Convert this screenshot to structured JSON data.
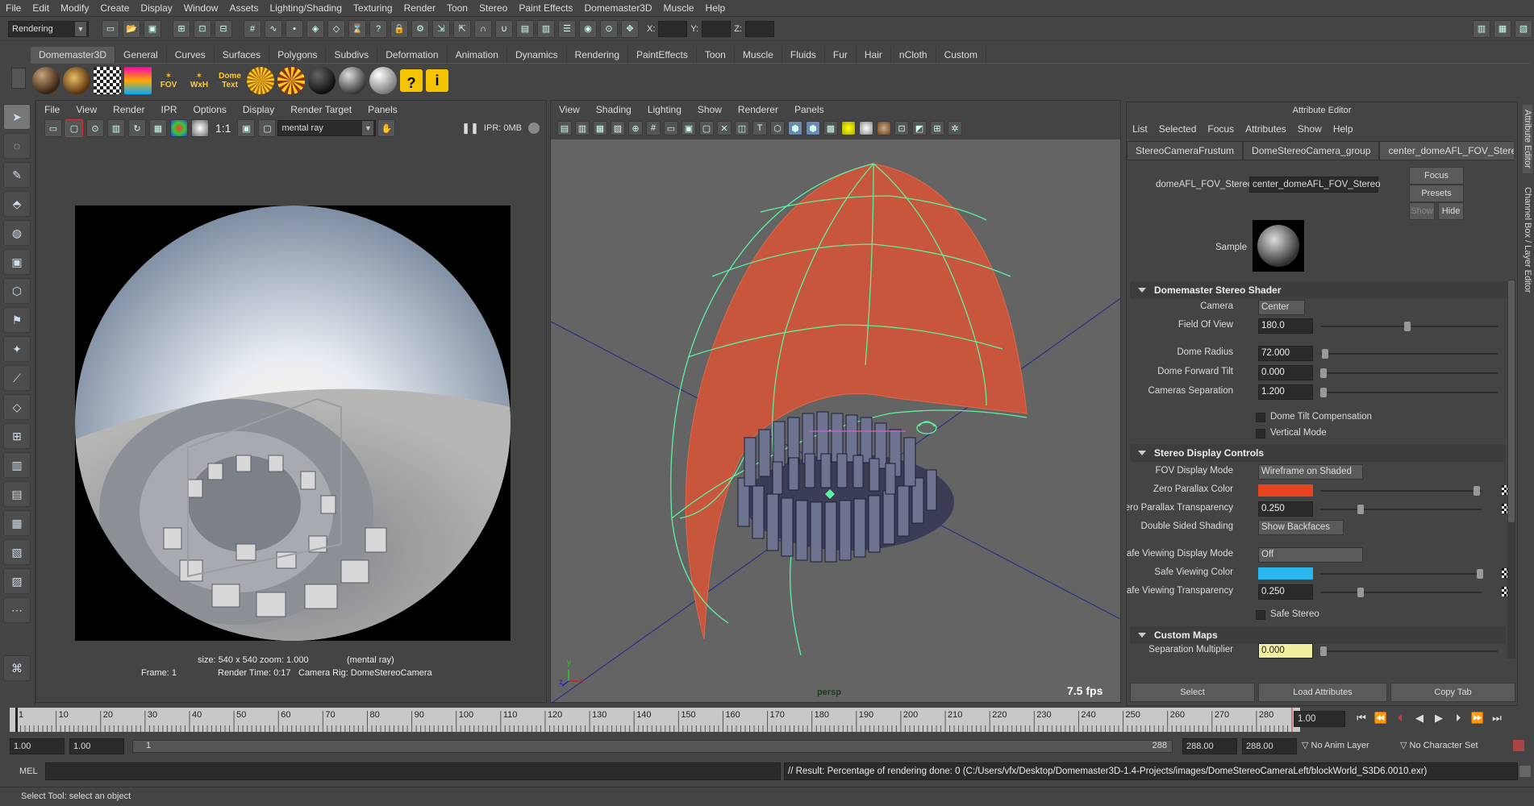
{
  "menubar": [
    "File",
    "Edit",
    "Modify",
    "Create",
    "Display",
    "Window",
    "Assets",
    "Lighting/Shading",
    "Texturing",
    "Render",
    "Toon",
    "Stereo",
    "Paint Effects",
    "Domemaster3D",
    "Muscle",
    "Help"
  ],
  "statusline": {
    "menuset": "Rendering",
    "x_label": "X:",
    "y_label": "Y:",
    "z_label": "Z:"
  },
  "shelf": {
    "tabs": [
      "Domemaster3D",
      "General",
      "Curves",
      "Surfaces",
      "Polygons",
      "Subdivs",
      "Deformation",
      "Animation",
      "Dynamics",
      "Rendering",
      "PaintEffects",
      "Toon",
      "Muscle",
      "Fluids",
      "Fur",
      "Hair",
      "nCloth",
      "Custom"
    ],
    "fov_label": "FOV",
    "wxh_label": "WxH",
    "dome_text_label": "Dome Text"
  },
  "renderview": {
    "menu": [
      "File",
      "View",
      "Render",
      "IPR",
      "Options",
      "Display",
      "Render Target",
      "Panels"
    ],
    "ratio": "1:1",
    "renderer": "mental ray",
    "ipr": "IPR: 0MB",
    "info_size": "size: 540 x 540 zoom: 1.000",
    "info_renderer": "(mental ray)",
    "info_frame": "Frame: 1",
    "info_time": "Render Time: 0:17",
    "info_rig": "Camera Rig: DomeStereoCamera"
  },
  "viewport": {
    "menu": [
      "View",
      "Shading",
      "Lighting",
      "Show",
      "Renderer",
      "Panels"
    ],
    "camera_name": "persp",
    "fps": "7.5 fps",
    "axis_x": "x",
    "axis_y": "y",
    "axis_z": "z"
  },
  "ae": {
    "title": "Attribute Editor",
    "menu": [
      "List",
      "Selected",
      "Focus",
      "Attributes",
      "Show",
      "Help"
    ],
    "tabs": [
      "StereoCameraFrustum",
      "DomeStereoCamera_group",
      "center_domeAFL_FOV_Stereo"
    ],
    "node_label": "domeAFL_FOV_Stereo:",
    "node_value": "center_domeAFL_FOV_Stereo",
    "focus": "Focus",
    "presets": "Presets",
    "show": "Show",
    "hide": "Hide",
    "sample_label": "Sample",
    "section1": "Domemaster Stereo Shader",
    "camera_label": "Camera",
    "camera_value": "Center",
    "fov_label": "Field Of View",
    "fov_value": "180.0",
    "radius_label": "Dome Radius",
    "radius_value": "72.000",
    "tilt_label": "Dome Forward Tilt",
    "tilt_value": "0.000",
    "sep_label": "Cameras Separation",
    "sep_value": "1.200",
    "tilt_comp": "Dome Tilt Compensation",
    "vertical": "Vertical Mode",
    "section2": "Stereo Display Controls",
    "fovmode_label": "FOV Display Mode",
    "fovmode_value": "Wireframe on Shaded",
    "zpc_label": "Zero Parallax Color",
    "zpc_color": "#e8451f",
    "zpt_label": "Zero Parallax Transparency",
    "zpt_value": "0.250",
    "dss_label": "Double Sided Shading",
    "dss_value": "Show Backfaces",
    "svdm_label": "Safe Viewing Display Mode",
    "svdm_value": "Off",
    "svc_label": "Safe Viewing Color",
    "svc_color": "#2bb8f0",
    "svt_label": "Safe Viewing Transparency",
    "svt_value": "0.250",
    "safe_stereo": "Safe Stereo",
    "section3": "Custom Maps",
    "sm_label": "Separation Multiplier",
    "sm_value": "0.000",
    "select": "Select",
    "load": "Load Attributes",
    "copy": "Copy Tab",
    "side_ae": "Attribute Editor",
    "side_cb": "Channel Box / Layer Editor"
  },
  "timeline": {
    "ticks": [
      1,
      10,
      20,
      30,
      40,
      50,
      60,
      70,
      80,
      90,
      100,
      110,
      120,
      130,
      140,
      150,
      160,
      170,
      180,
      190,
      200,
      210,
      220,
      230,
      240,
      250,
      260,
      270,
      280
    ],
    "current": "1.00",
    "start": "1.00",
    "start2": "1.00",
    "range_start": "1",
    "range_end": "288",
    "end": "288.00",
    "end2": "288.00",
    "anim_layer": "No Anim Layer",
    "char_set": "No Character Set"
  },
  "cmd": {
    "label": "MEL",
    "result": "// Result: Percentage of rendering done: 0 (C:/Users/vfx/Desktop/Domemaster3D-1.4-Projects/images/DomeStereoCameraLeft/blockWorld_S3D6.0010.exr)"
  },
  "help": "Select Tool: select an object"
}
